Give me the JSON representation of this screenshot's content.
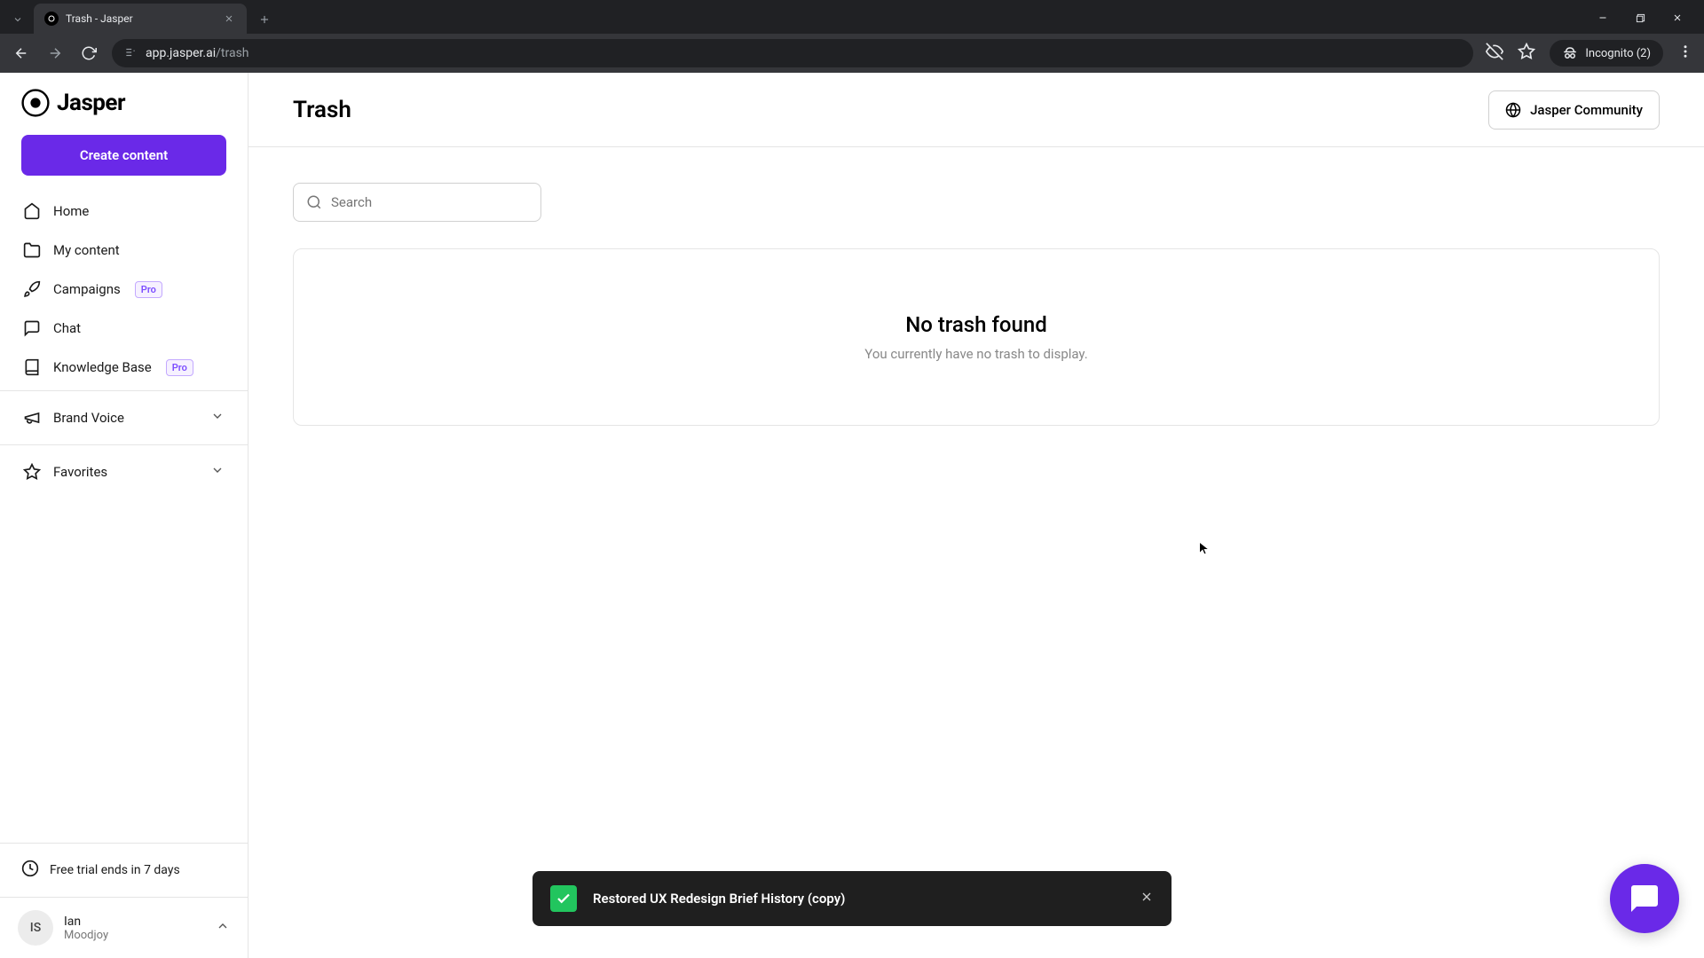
{
  "browser": {
    "tab_title": "Trash - Jasper",
    "url_host": "app.jasper.ai",
    "url_path": "/trash",
    "incognito_label": "Incognito (2)"
  },
  "sidebar": {
    "logo_text": "Jasper",
    "create_label": "Create content",
    "items": [
      {
        "label": "Home"
      },
      {
        "label": "My content"
      },
      {
        "label": "Campaigns",
        "badge": "Pro"
      },
      {
        "label": "Chat"
      },
      {
        "label": "Knowledge Base",
        "badge": "Pro"
      }
    ],
    "brand_voice_label": "Brand Voice",
    "favorites_label": "Favorites",
    "trial_label": "Free trial ends in 7 days",
    "user_initials": "IS",
    "user_name": "Ian",
    "user_org": "Moodjoy"
  },
  "header": {
    "title": "Trash",
    "community_label": "Jasper Community"
  },
  "search": {
    "placeholder": "Search",
    "value": ""
  },
  "empty": {
    "title": "No trash found",
    "subtitle": "You currently have no trash to display."
  },
  "toast": {
    "message": "Restored UX Redesign Brief History (copy)"
  }
}
